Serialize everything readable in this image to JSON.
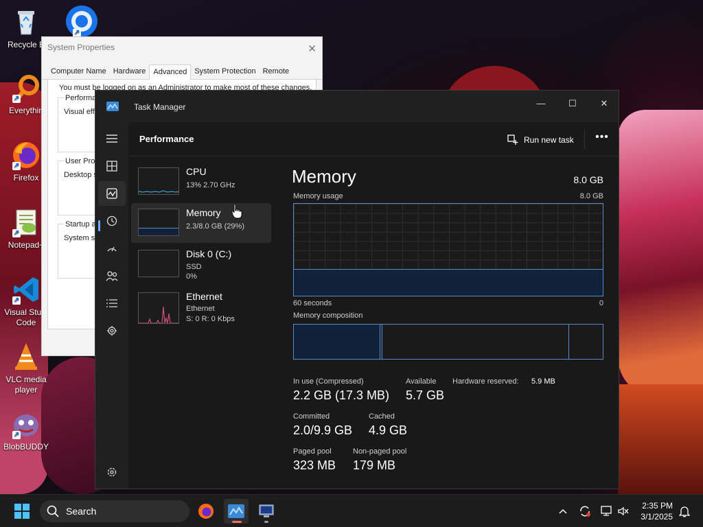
{
  "desktop": {
    "icons": [
      {
        "label": "Recycle B",
        "icon": "recycle-bin-icon"
      },
      {
        "label": "",
        "icon": "chrome-icon"
      },
      {
        "label": "Everythin",
        "icon": "everything-search-icon"
      },
      {
        "label": "Firefox",
        "icon": "firefox-icon"
      },
      {
        "label": "Notepad+",
        "icon": "notepad-plus-plus-icon"
      },
      {
        "label": "Visual Studi\nCode",
        "icon": "vscode-icon"
      },
      {
        "label": "VLC media\nplayer",
        "icon": "vlc-icon"
      },
      {
        "label": "BlobBUDDY",
        "icon": "blobbuddy-icon"
      }
    ]
  },
  "system_properties": {
    "title": "System Properties",
    "tabs": [
      "Computer Name",
      "Hardware",
      "Advanced",
      "System Protection",
      "Remote"
    ],
    "active_tab": "Advanced",
    "warning": "You must be logged on as an Administrator to make most of these changes.",
    "groups": [
      {
        "title": "Performan",
        "desc": "Visual effe"
      },
      {
        "title": "User Profil",
        "desc": "Desktop se"
      },
      {
        "title": "Startup an",
        "desc": "System sta"
      }
    ]
  },
  "task_manager": {
    "title": "Task Manager",
    "window_buttons": {
      "minimize": "—",
      "maximize": "☐",
      "close": "✕"
    },
    "page_title": "Performance",
    "run_new_task": "Run new task",
    "more": "•••",
    "resources": [
      {
        "name": "CPU",
        "line1": "13%  2.70 GHz",
        "line2": ""
      },
      {
        "name": "Memory",
        "line1": "2.3/8.0 GB (29%)",
        "line2": "",
        "selected": true
      },
      {
        "name": "Disk 0 (C:)",
        "line1": "SSD",
        "line2": "0%"
      },
      {
        "name": "Ethernet",
        "line1": "Ethernet",
        "line2": "S: 0  R: 0 Kbps"
      }
    ],
    "detail": {
      "title": "Memory",
      "total": "8.0 GB",
      "usage_label": "Memory usage",
      "usage_max": "8.0 GB",
      "time_label": "60 seconds",
      "time_min": "0",
      "usage_fraction": 0.29,
      "composition_label": "Memory composition",
      "stats": {
        "in_use_label": "In use (Compressed)",
        "in_use_value": "2.2 GB (17.3 MB)",
        "available_label": "Available",
        "available_value": "5.7 GB",
        "hw_reserved_label": "Hardware reserved:",
        "hw_reserved_value": "5.9 MB",
        "committed_label": "Committed",
        "committed_value": "2.0/9.9 GB",
        "cached_label": "Cached",
        "cached_value": "4.9 GB",
        "paged_label": "Paged pool",
        "paged_value": "323 MB",
        "nonpaged_label": "Non-paged pool",
        "nonpaged_value": "179 MB"
      }
    }
  },
  "taskbar": {
    "search_label": "Search",
    "clock_time": "2:35 PM",
    "clock_date": "3/1/2025"
  },
  "colors": {
    "accent": "#6ab0ff",
    "graph_line": "#5a8ac8",
    "graph_fill": "#12213a",
    "cpu_line": "#3aa0c8",
    "ethernet_line": "#d0507a"
  }
}
